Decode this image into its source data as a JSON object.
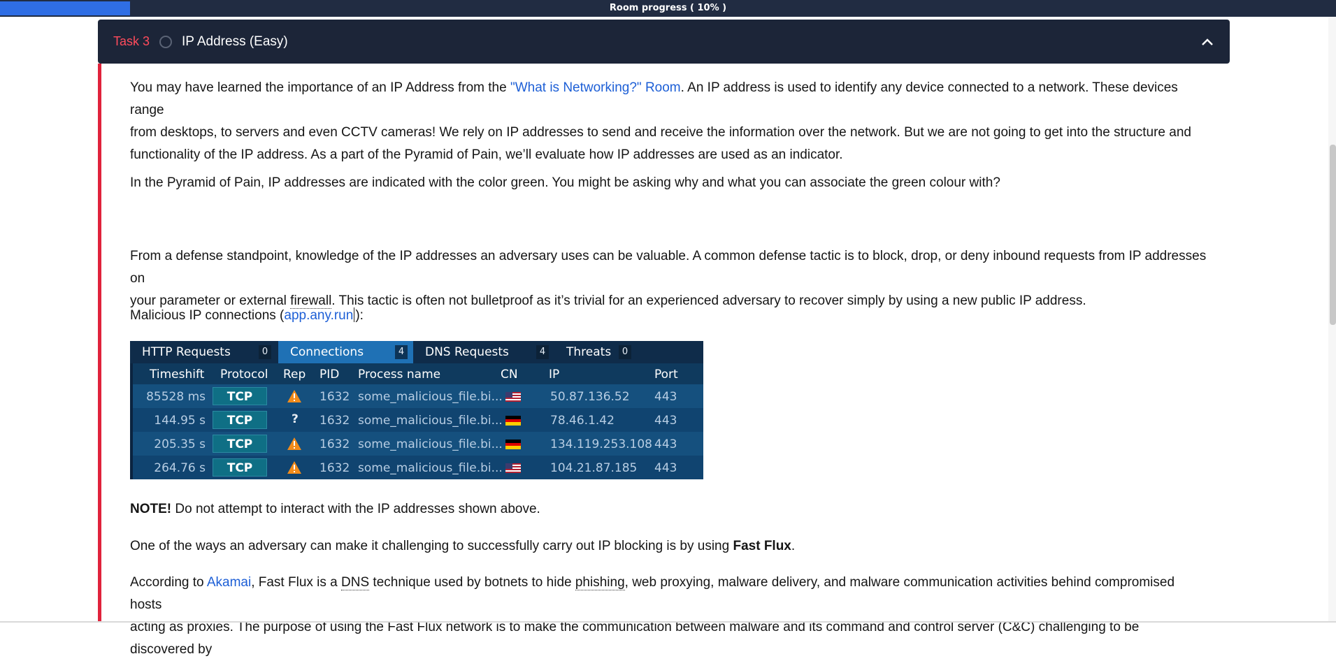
{
  "progress": {
    "label": "Room progress ( 10% )",
    "percent": 10,
    "fill_color": "#2f6ee4"
  },
  "task": {
    "number_label": "Task 3",
    "title": "IP Address (Easy)"
  },
  "paragraphs": {
    "p1_a": "You may have learned the importance of an IP Address from the ",
    "p1_link": "\"What is Networking?\" Room",
    "p1_b": ". An IP address is used to identify any device connected to a network. These devices range",
    "p1_line2": "from desktops, to servers and even CCTV cameras! We rely on IP addresses to send and receive the information over the network. But we are not going to get into the structure and",
    "p1_line3": "functionality of the IP address. As a part of the Pyramid of Pain, we’ll evaluate how IP addresses are used as an indicator.",
    "p2": "In the Pyramid of Pain, IP addresses are indicated with the color green. You might be asking why and what you can associate the green colour with?",
    "p3_line1": "From a defense standpoint, knowledge of the IP addresses an adversary uses can be valuable. A common defense tactic is to block, drop, or deny inbound requests from IP addresses on",
    "p3_a": "your parameter or external ",
    "p3_firewall": "firewall",
    "p3_b": ". This tactic is often not bulletproof as it’s trivial for an experienced adversary to recover simply by using a new public IP address.",
    "p4_a": "Malicious IP connections (",
    "p4_link_a": "app.any.run",
    "p4_b": "):",
    "note_bold": "NOTE!",
    "note_text": " Do not attempt to interact with the IP addresses shown above.",
    "p5_a": "One of the ways an adversary can make it challenging to successfully carry out IP blocking is by using ",
    "p5_bold": "Fast Flux",
    "p5_b": ".",
    "p6_a": "According to ",
    "p6_link": "Akamai",
    "p6_b": ", Fast Flux is a ",
    "p6_dns": "DNS",
    "p6_c": " technique used by botnets to hide ",
    "p6_phishing": "phishing",
    "p6_d": ", web proxying, malware delivery, and malware communication activities behind compromised hosts",
    "p6_line2": "acting as proxies. The purpose of using the Fast Flux network is to make the communication between malware and its command and control server (C&C) challenging to be discovered by"
  },
  "anyrun": {
    "tabs": [
      {
        "label": "HTTP Requests",
        "count": "0"
      },
      {
        "label": "Connections",
        "count": "4"
      },
      {
        "label": "DNS Requests",
        "count": "4"
      },
      {
        "label": "Threats",
        "count": "0"
      }
    ],
    "columns": [
      "Timeshift",
      "Protocol",
      "Rep",
      "PID",
      "Process name",
      "CN",
      "IP",
      "Port"
    ],
    "rows": [
      {
        "timeshift": "85528 ms",
        "protocol": "TCP",
        "rep": "warning-icon",
        "pid": "1632",
        "process": "some_malicious_file.bi...",
        "cn": "us-flag-icon",
        "ip": "50.87.136.52",
        "port": "443"
      },
      {
        "timeshift": "144.95 s",
        "protocol": "TCP",
        "rep": "?",
        "pid": "1632",
        "process": "some_malicious_file.bi...",
        "cn": "de-flag-icon",
        "ip": "78.46.1.42",
        "port": "443"
      },
      {
        "timeshift": "205.35 s",
        "protocol": "TCP",
        "rep": "warning-icon",
        "pid": "1632",
        "process": "some_malicious_file.bi...",
        "cn": "de-flag-icon",
        "ip": "134.119.253.108",
        "port": "443"
      },
      {
        "timeshift": "264.76 s",
        "protocol": "TCP",
        "rep": "warning-icon",
        "pid": "1632",
        "process": "some_malicious_file.bi...",
        "cn": "us-flag-icon",
        "ip": "104.21.87.185",
        "port": "443"
      }
    ]
  },
  "colors": {
    "accent_red": "#e0233c",
    "header_bg": "#1c2538",
    "link": "#1d5fd6"
  }
}
